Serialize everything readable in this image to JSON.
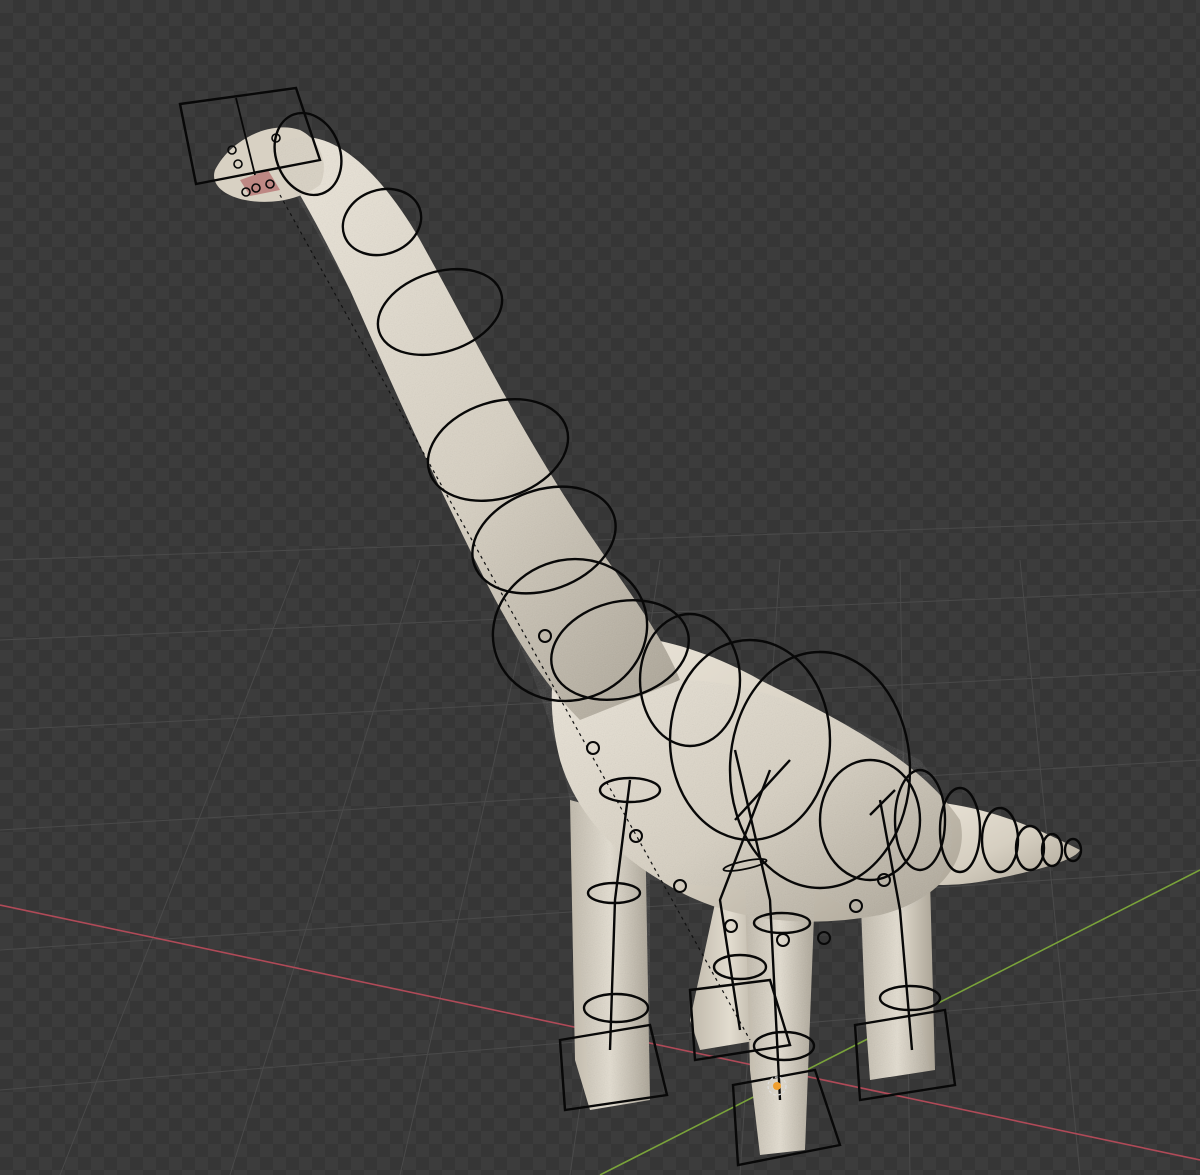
{
  "viewport": {
    "background": "checkerboard-dark",
    "grid_color": "#4a4a4a",
    "x_axis_color": "#b04a58",
    "y_axis_color": "#7aa33a"
  },
  "scene": {
    "model": "brachiosaurus-mesh",
    "skin_color": "#d7d0c2",
    "rig_color": "#080808",
    "origin_marker_color": "#f0a030"
  }
}
